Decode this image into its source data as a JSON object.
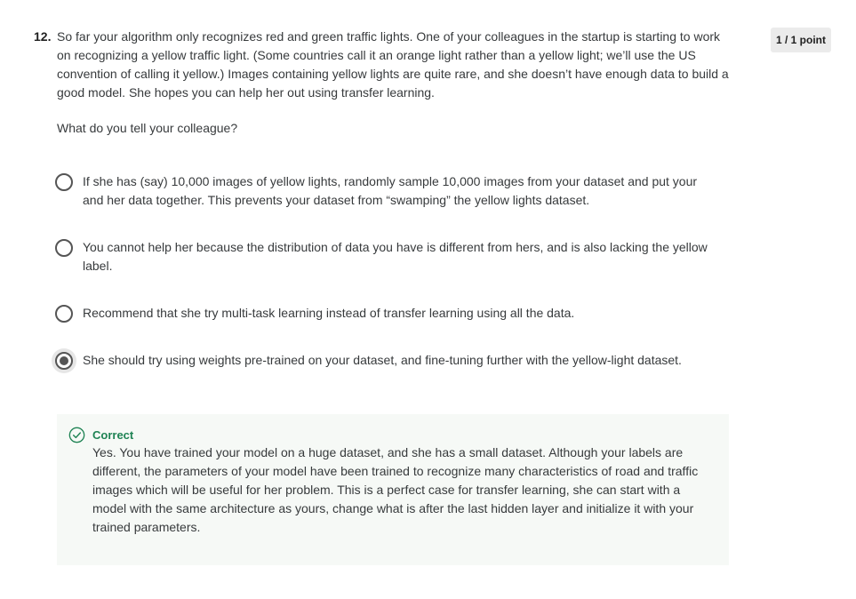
{
  "question": {
    "number": "12.",
    "text": "So far your algorithm only recognizes red and green traffic lights. One of your colleagues in the startup is starting to work on recognizing a yellow traffic light. (Some countries call it an orange light rather than a yellow light; we’ll use the US convention of calling it yellow.) Images containing yellow lights are quite rare, and she doesn’t have enough data to build a good model. She hopes you can help her out using transfer learning.",
    "prompt": "What do you tell your colleague?",
    "points": "1 / 1 point"
  },
  "options": [
    {
      "label": "If she has (say) 10,000 images of yellow lights, randomly sample 10,000 images from your dataset and put your and her data together. This prevents your dataset from “swamping” the yellow lights dataset.",
      "selected": false
    },
    {
      "label": "You cannot help her because the distribution of data you have is different from hers, and is also lacking the yellow label.",
      "selected": false
    },
    {
      "label": "Recommend that she try multi-task learning instead of transfer learning using all the data.",
      "selected": false
    },
    {
      "label": "She should try using weights pre-trained on your dataset, and fine-tuning further with the yellow-light dataset.",
      "selected": true
    }
  ],
  "feedback": {
    "status": "Correct",
    "icon": "check-circle-icon",
    "text": "Yes. You have trained your model on a huge dataset, and she has a small dataset. Although your labels are different, the parameters of your model have been trained to recognize many characteristics of road and traffic images which will be useful for her problem. This is a perfect case for transfer learning, she can start with a model with the same architecture as yours, change what is after the last hidden layer and initialize it with your trained parameters.",
    "accent_color": "#1f8354",
    "background_color": "#f6f9f6"
  }
}
